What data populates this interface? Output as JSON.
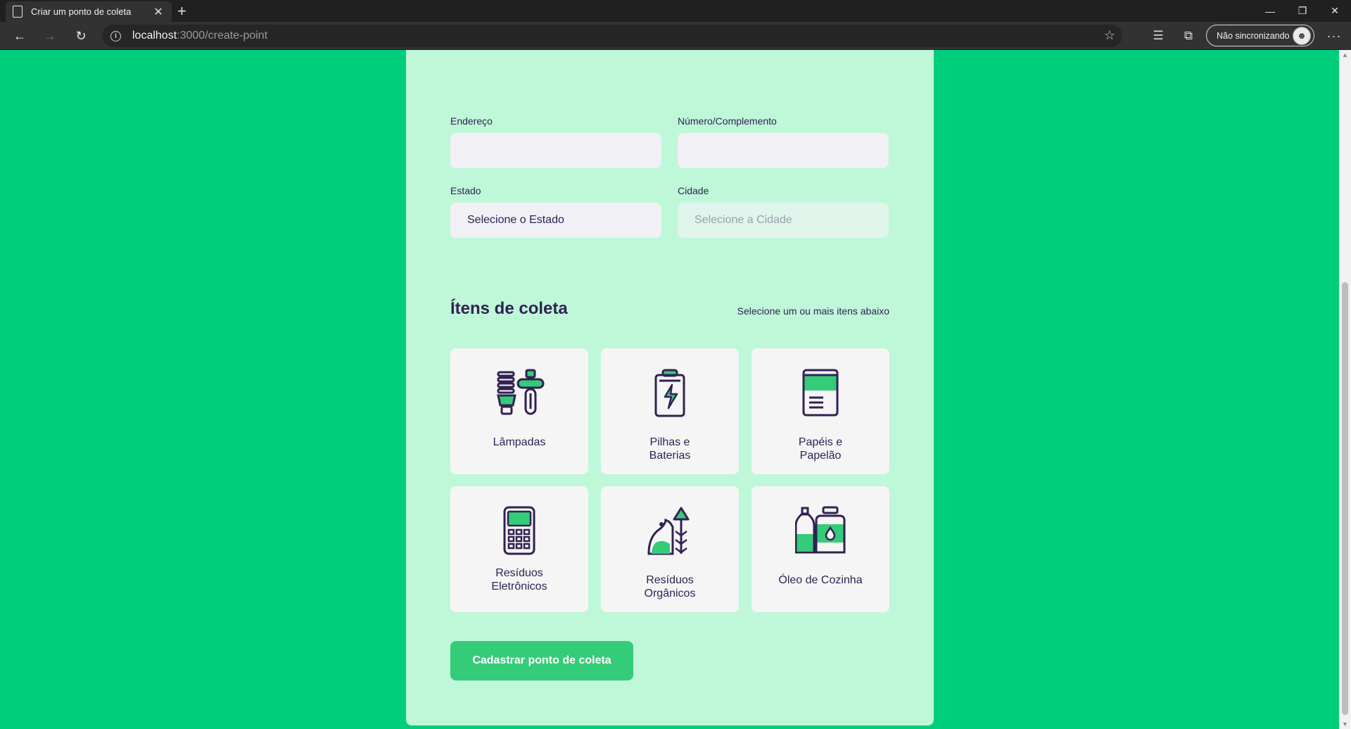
{
  "browser": {
    "tab_title": "Criar um ponto de coleta",
    "new_tab_label": "+",
    "url_host": "localhost",
    "url_path": ":3000/create-point",
    "sync_label": "Não sincronizando"
  },
  "form": {
    "address_label": "Endereço",
    "address_value": "",
    "number_label": "Número/Complemento",
    "number_value": "",
    "state_label": "Estado",
    "state_value": "Selecione o Estado",
    "city_label": "Cidade",
    "city_value": "Selecione a Cidade"
  },
  "items_section": {
    "title": "Ítens de coleta",
    "hint": "Selecione um ou mais itens abaixo",
    "items": [
      {
        "label": "Lâmpadas",
        "icon": "lamp-icon"
      },
      {
        "label": "Pilhas e Baterias",
        "icon": "battery-icon"
      },
      {
        "label": "Papéis e Papelão",
        "icon": "paper-icon"
      },
      {
        "label": "Resíduos Eletrônicos",
        "icon": "electronics-icon"
      },
      {
        "label": "Resíduos Orgânicos",
        "icon": "organic-icon"
      },
      {
        "label": "Óleo de Cozinha",
        "icon": "oil-icon"
      }
    ]
  },
  "submit_label": "Cadastrar ponto de coleta",
  "colors": {
    "page_bg": "#00CE7B",
    "card_bg": "#BEF8D9",
    "accent": "#34CB79",
    "text": "#322153",
    "input_bg": "#F0F0F5"
  }
}
